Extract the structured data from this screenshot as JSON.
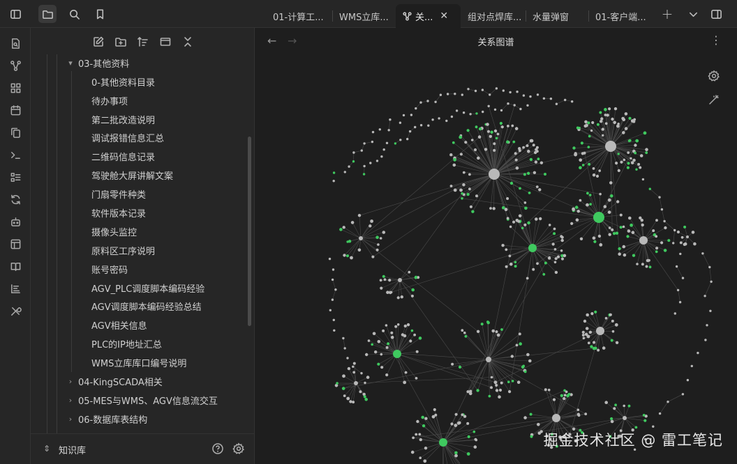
{
  "window": {
    "tabs": [
      {
        "label": "01-计算工...",
        "active": false
      },
      {
        "label": "WMS立库...",
        "active": false
      },
      {
        "label": "关...",
        "active": true,
        "icon": "graph-icon"
      },
      {
        "label": "组对点焊库...",
        "active": false
      },
      {
        "label": "水量弹窗",
        "active": false
      },
      {
        "label": "01-客户端...",
        "active": false
      }
    ],
    "new_tab_label": "+",
    "tab_list_label": "⌄"
  },
  "ribbon": {
    "icons": [
      "file-search-icon",
      "graph-icon",
      "grid-icon",
      "calendar-icon",
      "copy-icon",
      "terminal-icon",
      "checklist-icon",
      "sync-icon",
      "bot-icon",
      "layout-icon",
      "book-icon",
      "list-icon",
      "tools-icon"
    ]
  },
  "sidebar": {
    "tree": [
      {
        "label": "03-其他资料",
        "level": 0,
        "expanded": true,
        "folder": true
      },
      {
        "label": "0-其他资料目录",
        "level": 1
      },
      {
        "label": "待办事项",
        "level": 1
      },
      {
        "label": "第二批改造说明",
        "level": 1
      },
      {
        "label": "调试报错信息汇总",
        "level": 1
      },
      {
        "label": "二维码信息记录",
        "level": 1
      },
      {
        "label": "驾驶舱大屏讲解文案",
        "level": 1
      },
      {
        "label": "门扇零件种类",
        "level": 1
      },
      {
        "label": "软件版本记录",
        "level": 1
      },
      {
        "label": "摄像头监控",
        "level": 1
      },
      {
        "label": "原料区工序说明",
        "level": 1
      },
      {
        "label": "账号密码",
        "level": 1
      },
      {
        "label": "AGV_PLC调度脚本编码经验",
        "level": 1
      },
      {
        "label": "AGV调度脚本编码经验总结",
        "level": 1
      },
      {
        "label": "AGV相关信息",
        "level": 1
      },
      {
        "label": "PLC的IP地址汇总",
        "level": 1
      },
      {
        "label": "WMS立库库口编号说明",
        "level": 1
      },
      {
        "label": "04-KingSCADA相关",
        "level": 0,
        "expanded": false,
        "folder": true
      },
      {
        "label": "05-MES与WMS、AGV信息流交互",
        "level": 0,
        "expanded": false,
        "folder": true
      },
      {
        "label": "06-数据库表结构",
        "level": 0,
        "expanded": false,
        "folder": true
      }
    ],
    "vault_name": "知识库"
  },
  "main": {
    "title": "关系图谱",
    "back_label": "←",
    "forward_label": "→",
    "more_label": "⋮"
  },
  "colors": {
    "node_gray": "#b9b9b9",
    "node_green": "#3fc95f",
    "edge": "#4a4a4a",
    "background": "#1e1e1e"
  },
  "watermark": "掘金技术社区 @ 雷工笔记"
}
